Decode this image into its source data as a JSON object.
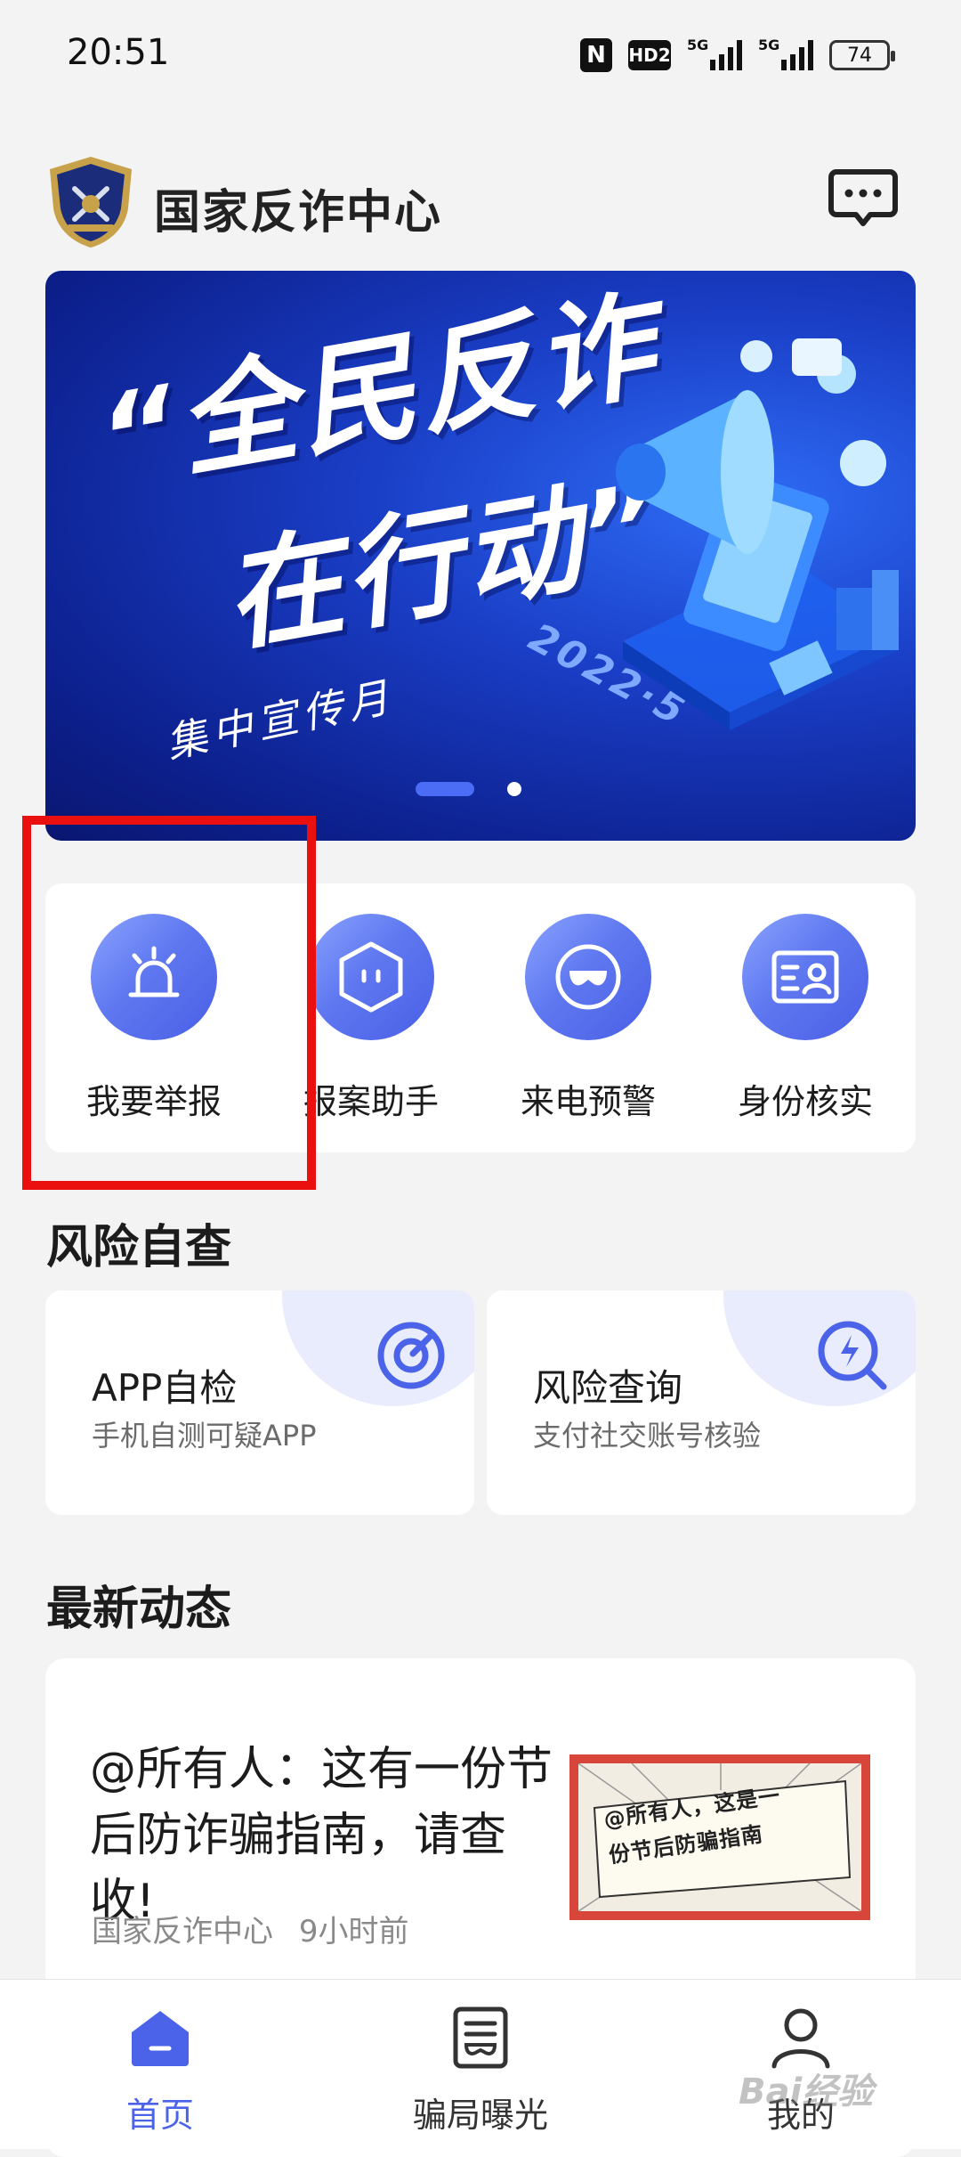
{
  "status_bar": {
    "time": "20:51",
    "nfc_label": "N",
    "hd_label": "HD2",
    "signal_1_label": "5G",
    "signal_2_label": "5G",
    "battery": "74"
  },
  "header": {
    "title": "国家反诈中心",
    "logo_icon": "police-badge-icon",
    "message_icon": "chat-bubble-icon"
  },
  "banner": {
    "slogan_line_1": "“全民反诈",
    "slogan_line_2": "在行动”",
    "subtitle": "集中宣传月",
    "date": "2022·5",
    "page_indicator": {
      "total": 2,
      "active": 1
    }
  },
  "quick_actions": [
    {
      "label": "我要举报",
      "icon": "alarm-light-icon"
    },
    {
      "label": "报案助手",
      "icon": "robot-hexagon-icon"
    },
    {
      "label": "来电预警",
      "icon": "mask-icon"
    },
    {
      "label": "身份核实",
      "icon": "id-card-icon"
    }
  ],
  "risk_section": {
    "title": "风险自查",
    "cards": [
      {
        "title": "APP自检",
        "subtitle": "手机自测可疑APP",
        "icon": "target-scan-icon"
      },
      {
        "title": "风险查询",
        "subtitle": "支付社交账号核验",
        "icon": "search-bolt-icon"
      }
    ]
  },
  "news_section": {
    "title": "最新动态",
    "items": [
      {
        "title_line_1": "@所有人：这有一份节",
        "title_line_2": "后防诈骗指南，请查收!",
        "source": "国家反诈中心",
        "time": "9小时前",
        "thumb_text_1": "@所有人，这是一",
        "thumb_text_2": "份节后防骗指南"
      }
    ]
  },
  "bottom_nav": [
    {
      "label": "首页",
      "icon": "home-icon",
      "active": true
    },
    {
      "label": "骗局曝光",
      "icon": "document-mask-icon",
      "active": false
    },
    {
      "label": "我的",
      "icon": "user-icon",
      "active": false
    }
  ],
  "watermark": "Bai经验",
  "colors": {
    "accent": "#4b63e8",
    "highlight_box": "#ea1010",
    "background": "#f3f3f3",
    "banner_dark": "#0c1f8c"
  }
}
